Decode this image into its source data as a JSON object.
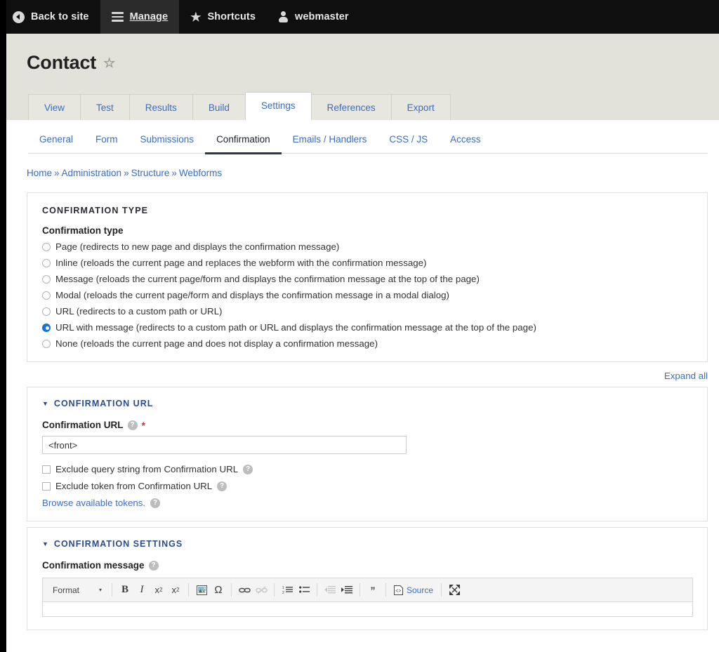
{
  "toolbar": {
    "back_to_site": "Back to site",
    "manage": "Manage",
    "shortcuts": "Shortcuts",
    "user": "webmaster",
    "icons": {
      "back": "back-arrow-icon",
      "manage": "hamburger-icon",
      "shortcuts": "star-icon",
      "user": "user-icon"
    }
  },
  "page": {
    "title": "Contact",
    "favorite_icon": "star-outline-icon"
  },
  "primary_tabs": [
    {
      "label": "View",
      "active": false
    },
    {
      "label": "Test",
      "active": false
    },
    {
      "label": "Results",
      "active": false
    },
    {
      "label": "Build",
      "active": false
    },
    {
      "label": "Settings",
      "active": true
    },
    {
      "label": "References",
      "active": false
    },
    {
      "label": "Export",
      "active": false
    }
  ],
  "secondary_tabs": [
    {
      "label": "General",
      "active": false
    },
    {
      "label": "Form",
      "active": false
    },
    {
      "label": "Submissions",
      "active": false
    },
    {
      "label": "Confirmation",
      "active": true
    },
    {
      "label": "Emails / Handlers",
      "active": false
    },
    {
      "label": "CSS / JS",
      "active": false
    },
    {
      "label": "Access",
      "active": false
    }
  ],
  "breadcrumb": [
    "Home",
    "Administration",
    "Structure",
    "Webforms"
  ],
  "breadcrumb_separator": "»",
  "confirmation_type": {
    "legend": "CONFIRMATION TYPE",
    "label": "Confirmation type",
    "options": [
      {
        "label": "Page (redirects to new page and displays the confirmation message)",
        "selected": false
      },
      {
        "label": "Inline (reloads the current page and replaces the webform with the confirmation message)",
        "selected": false
      },
      {
        "label": "Message (reloads the current page/form and displays the confirmation message at the top of the page)",
        "selected": false
      },
      {
        "label": "Modal (reloads the current page/form and displays the confirmation message in a modal dialog)",
        "selected": false
      },
      {
        "label": "URL (redirects to a custom path or URL)",
        "selected": false
      },
      {
        "label": "URL with message (redirects to a custom path or URL and displays the confirmation message at the top of the page)",
        "selected": true
      },
      {
        "label": "None (reloads the current page and does not display a confirmation message)",
        "selected": false
      }
    ]
  },
  "expand_all": "Expand all",
  "confirmation_url": {
    "summary": "CONFIRMATION URL",
    "triangle": "▼",
    "field_label": "Confirmation URL",
    "required_marker": "*",
    "help_icon": "question-mark-icon",
    "value": "<front>",
    "placeholder": "",
    "checkboxes": [
      {
        "label": "Exclude query string from Confirmation URL",
        "checked": false
      },
      {
        "label": "Exclude token from Confirmation URL",
        "checked": false
      }
    ],
    "token_link": "Browse available tokens."
  },
  "confirmation_settings": {
    "summary": "CONFIRMATION SETTINGS",
    "triangle": "▼",
    "message_label": "Confirmation message",
    "help_icon": "question-mark-icon"
  },
  "editor": {
    "format_label": "Format",
    "caret": "▾",
    "source_label": "Source",
    "buttons": [
      {
        "name": "bold",
        "glyph": "B"
      },
      {
        "name": "italic",
        "glyph": "I"
      },
      {
        "name": "subscript",
        "glyph": "x"
      },
      {
        "name": "superscript",
        "glyph": "x"
      },
      {
        "name": "image",
        "glyph": ""
      },
      {
        "name": "special-character",
        "glyph": "Ω"
      },
      {
        "name": "link",
        "glyph": ""
      },
      {
        "name": "unlink",
        "glyph": ""
      },
      {
        "name": "numbered-list",
        "glyph": ""
      },
      {
        "name": "bulleted-list",
        "glyph": ""
      },
      {
        "name": "outdent",
        "glyph": ""
      },
      {
        "name": "indent",
        "glyph": ""
      },
      {
        "name": "blockquote",
        "glyph": "”"
      },
      {
        "name": "source",
        "glyph": ""
      },
      {
        "name": "maximize",
        "glyph": ""
      }
    ]
  },
  "colors": {
    "toolbar_bg": "#0f0f0f",
    "header_bg": "#e2e2da",
    "link": "#3b6dc4",
    "accent_radio": "#1a73d8",
    "required": "#e02b2b",
    "summary": "#2a4b8d"
  }
}
